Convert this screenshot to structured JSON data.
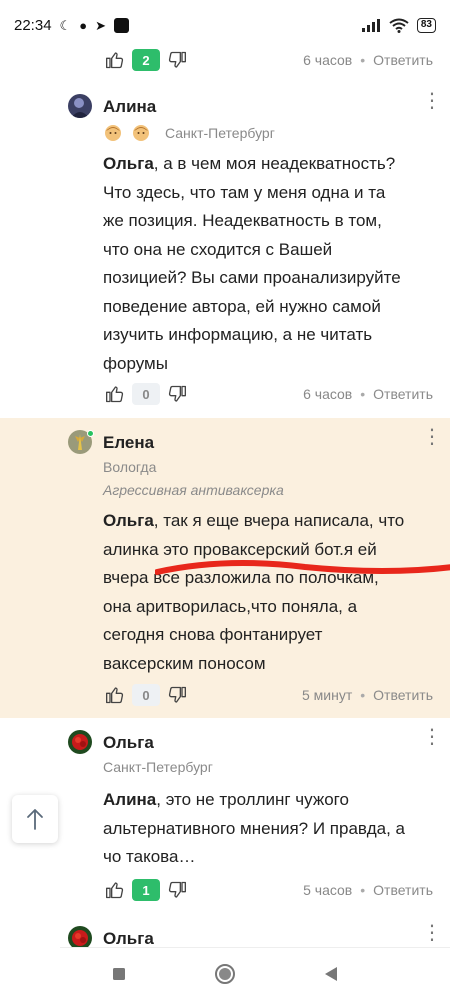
{
  "status_bar": {
    "time": "22:34",
    "signal_icon": "signal-icon",
    "wifi_icon": "wifi-icon",
    "battery": "83"
  },
  "top_meta": {
    "votes": "2",
    "time": "6 часов",
    "reply": "Ответить"
  },
  "comments": [
    {
      "author": "Алина",
      "city": "Санкт-Петербург",
      "mention": "Ольга",
      "text_lines": [
        ", а в чем моя неадекватность?",
        "Что здесь, что там у меня одна и та",
        "же позиция. Неадекватность в том,",
        "что она не сходится с Вашей",
        "позицией? Вы сами проанализируйте",
        "поведение автора, ей нужно самой",
        "изучить информацию, а не читать",
        "форумы"
      ],
      "votes": "0",
      "time": "6 часов",
      "reply": "Ответить"
    },
    {
      "author": "Елена",
      "city": "Вологда",
      "role": "Агрессивная антиваксерка",
      "mention": "Ольга",
      "text_lines": [
        ", так я еще вчера написала, что",
        "алинка это проваксерский бот.я ей",
        "вчера все разложила по полочкам,",
        "она аритворилась,что поняла, а",
        "сегодня снова фонтанирует",
        "ваксерским поносом"
      ],
      "votes": "0",
      "time": "5 минут",
      "reply": "Ответить",
      "accent": "#fbf0df"
    },
    {
      "author": "Ольга",
      "city": "Санкт-Петербург",
      "mention": "Алина",
      "text_lines": [
        ", это не троллинг чужого",
        "альтернативного мнения? И правда, а",
        "чо такова…"
      ],
      "votes": "1",
      "time": "5 часов",
      "reply": "Ответить"
    },
    {
      "author": "Ольга"
    }
  ],
  "colors": {
    "positive_vote": "#2ebd6b",
    "annotation_red": "#e8271b"
  },
  "icons": [
    "thumb-up-icon",
    "thumb-down-icon",
    "more-vert-icon",
    "arrow-up-icon",
    "nav-square-icon",
    "nav-circle-icon",
    "nav-back-icon"
  ]
}
